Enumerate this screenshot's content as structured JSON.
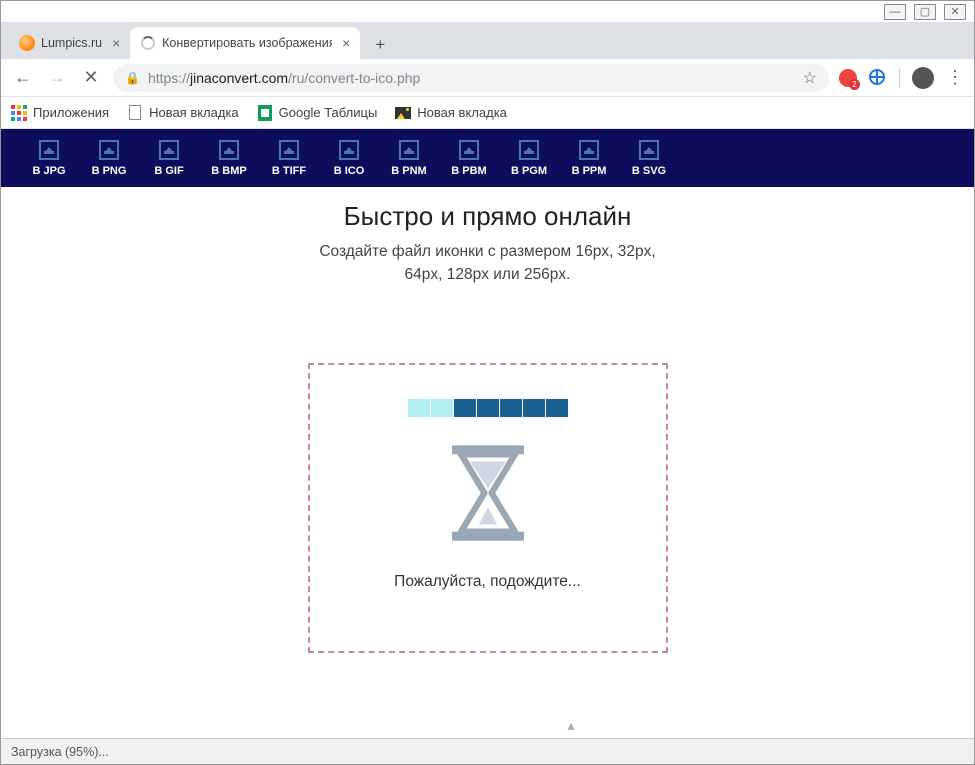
{
  "window_controls": {
    "min": "—",
    "max": "▢",
    "close": "✕"
  },
  "tabs": [
    {
      "title": "Lumpics.ru",
      "active": false,
      "favicon": "orange"
    },
    {
      "title": "Конвертировать изображения в",
      "active": true,
      "favicon": "spinner"
    }
  ],
  "address_bar": {
    "scheme": "https://",
    "host": "jinaconvert.com",
    "path": "/ru/convert-to-ico.php"
  },
  "ext_badge": "2",
  "bookmarks": [
    {
      "label": "Приложения",
      "icon": "apps"
    },
    {
      "label": "Новая вкладка",
      "icon": "file"
    },
    {
      "label": "Google Таблицы",
      "icon": "sheets"
    },
    {
      "label": "Новая вкладка",
      "icon": "pic"
    }
  ],
  "formats": [
    "В JPG",
    "В PNG",
    "В GIF",
    "В BMP",
    "В TIFF",
    "В ICO",
    "В PNM",
    "В PBM",
    "В PGM",
    "В PPM",
    "В SVG"
  ],
  "headline": "Быстро и прямо онлайн",
  "subline1": "Создайте файл иконки с размером 16px, 32px,",
  "subline2": "64px, 128px или 256px.",
  "wait_text": "Пожалуйста, подождите...",
  "status_text": "Загрузка (95%)..."
}
